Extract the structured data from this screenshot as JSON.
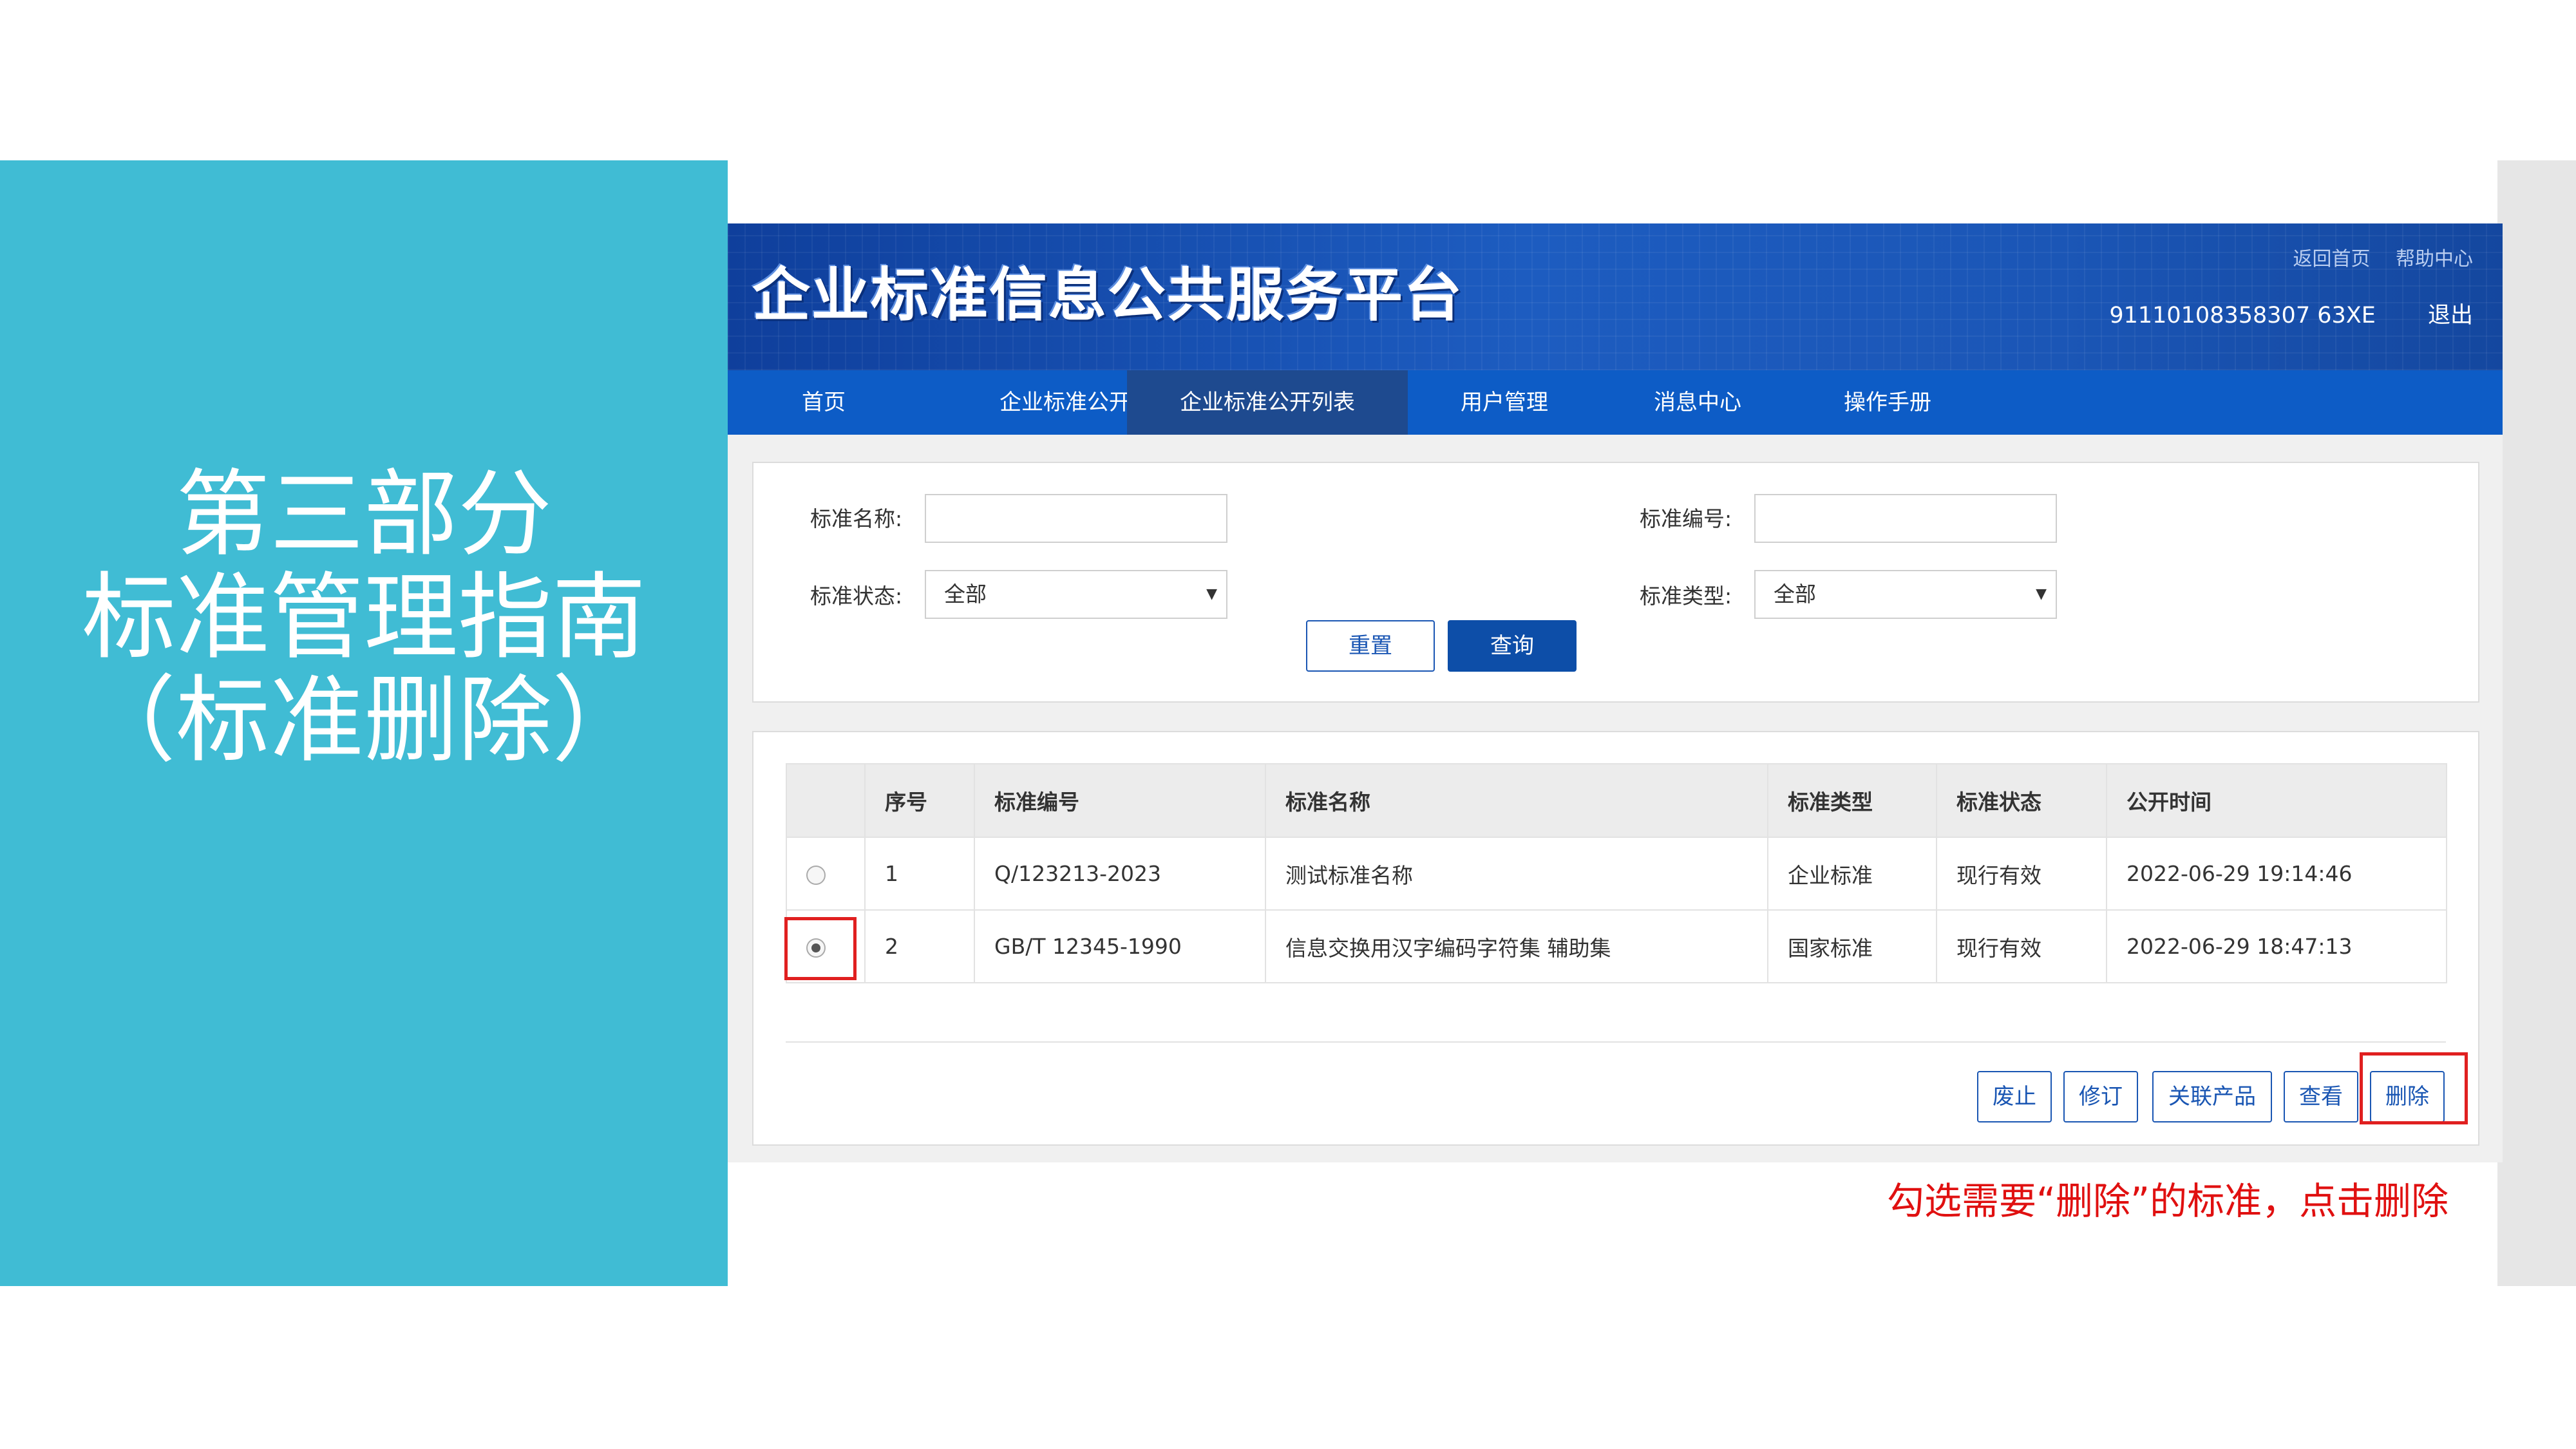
{
  "slide": {
    "title_lines": [
      "第三部分",
      "标准管理指南",
      "（标准删除）"
    ],
    "hint": "勾选需要“删除”的标准，点击删除"
  },
  "header": {
    "logo": "企业标准信息公共服务平台",
    "links": [
      "返回首页",
      "帮助中心"
    ],
    "user_id": "91110108358307 63XE",
    "logout": "退出"
  },
  "nav": [
    "首页",
    "企业标准公开",
    "企业标准公开列表",
    "用户管理",
    "消息中心",
    "操作手册"
  ],
  "search": {
    "name_label": "标准名称:",
    "name_value": "",
    "code_label": "标准编号:",
    "code_value": "",
    "status_label": "标准状态:",
    "status_value": "全部",
    "type_label": "标准类型:",
    "type_value": "全部",
    "reset": "重置",
    "query": "查询"
  },
  "table": {
    "headers": [
      "",
      "序号",
      "标准编号",
      "标准名称",
      "标准类型",
      "标准状态",
      "公开时间"
    ],
    "rows": [
      {
        "selected": false,
        "no": "1",
        "code": "Q/123213-2023",
        "name": "测试标准名称",
        "type": "企业标准",
        "status": "现行有效",
        "time": "2022-06-29 19:14:46"
      },
      {
        "selected": true,
        "no": "2",
        "code": "GB/T 12345-1990",
        "name": "信息交换用汉字编码字符集 辅助集",
        "type": "国家标准",
        "status": "现行有效",
        "time": "2022-06-29 18:47:13"
      }
    ]
  },
  "actions": [
    "废止",
    "修订",
    "关联产品",
    "查看",
    "删除"
  ],
  "colors": {
    "slide_cyan": "#40bcd4",
    "header_blue": "#1d5cc0",
    "nav_blue": "#0d5cc6",
    "nav_active": "#1e4a8f",
    "highlight_red": "#e02020"
  }
}
